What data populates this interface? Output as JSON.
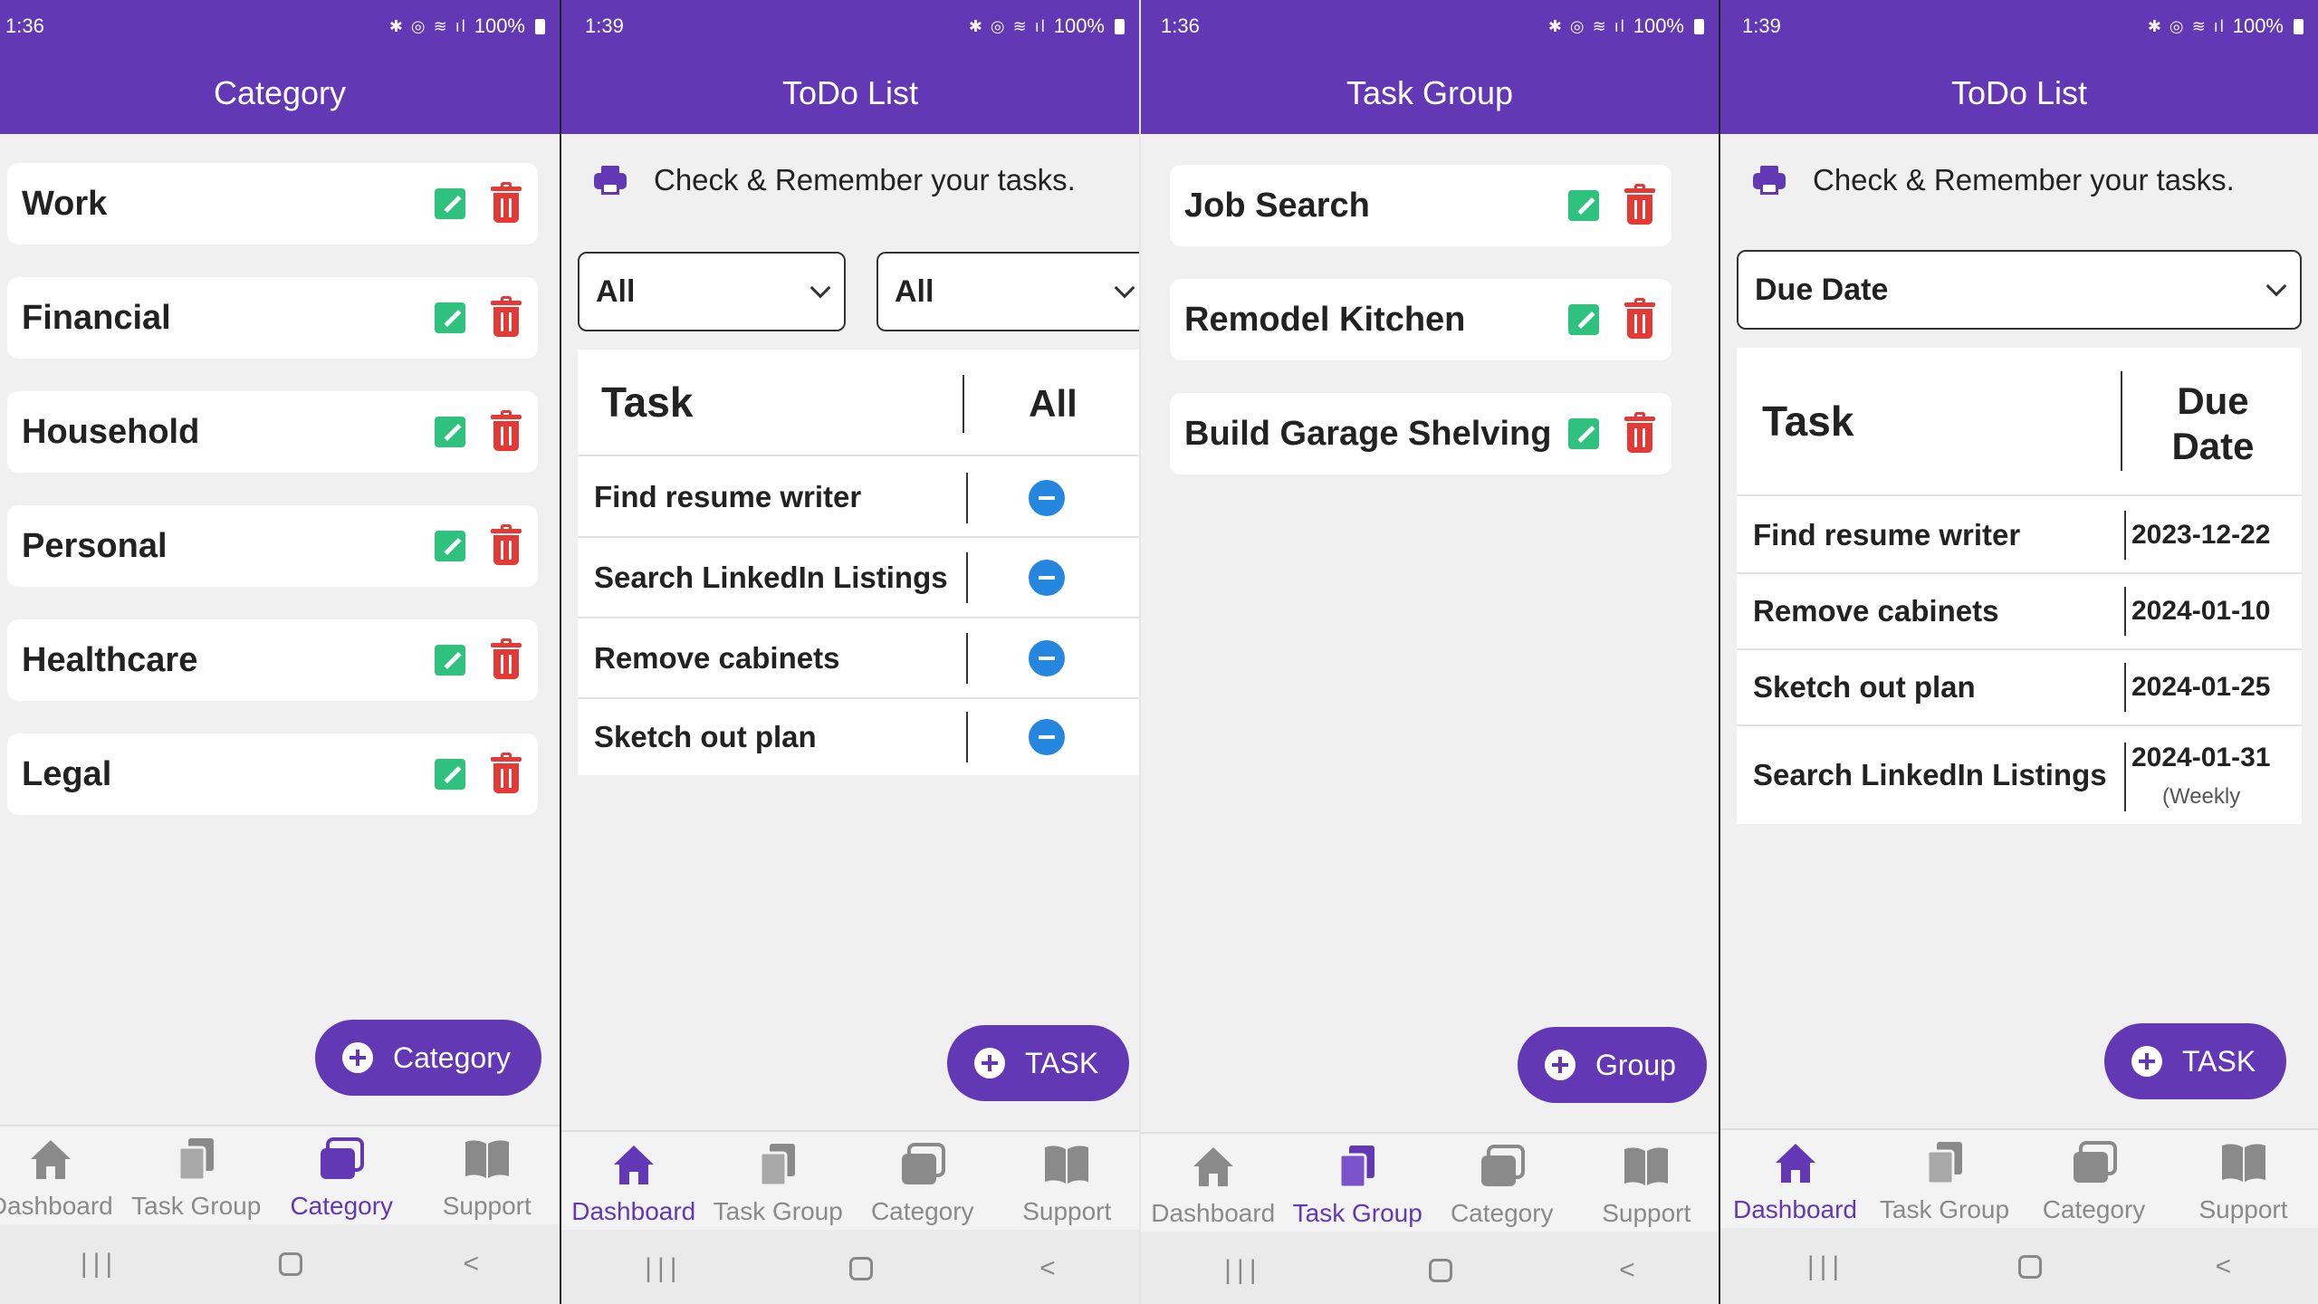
{
  "theme": {
    "primary": "#6238b5",
    "edit_green": "#2ec27e",
    "delete_red": "#e53935",
    "minus_blue": "#2586e0"
  },
  "status": {
    "battery": "100%",
    "icons": "✱ ◎ ≋ ıl"
  },
  "nav": {
    "dashboard": "Dashboard",
    "task_group": "Task Group",
    "category": "Category",
    "support": "Support",
    "dashboard_clipped": "Dashboard",
    "system": {
      "recents": "|||",
      "back": "<"
    }
  },
  "screen1": {
    "time": "1:36",
    "title": "Category",
    "items": [
      "Work",
      "Financial",
      "Household",
      "Personal",
      "Healthcare",
      "Legal"
    ],
    "fab_label": "Category",
    "active_tab": "Category"
  },
  "screen2": {
    "time": "1:39",
    "title": "ToDo List",
    "header_text": "Check & Remember your tasks.",
    "filter1": "All",
    "filter2": "All",
    "col_task": "Task",
    "col_status": "All",
    "rows": [
      "Find resume writer",
      "Search LinkedIn Listings",
      "Remove cabinets",
      "Sketch out plan"
    ],
    "fab_label": "TASK",
    "active_tab": "Dashboard"
  },
  "screen3": {
    "time": "1:36",
    "title": "Task Group",
    "items": [
      "Job Search",
      "Remodel Kitchen",
      "Build Garage Shelving"
    ],
    "fab_label": "Group",
    "active_tab": "Task Group"
  },
  "screen4": {
    "time": "1:39",
    "title": "ToDo List",
    "header_text": "Check & Remember your tasks.",
    "sort": "Due Date",
    "col_task": "Task",
    "col_due_line1": "Due",
    "col_due_line2": "Date",
    "rows": [
      {
        "task": "Find resume writer",
        "date": "2023-12-22"
      },
      {
        "task": "Remove cabinets",
        "date": "2024-01-10"
      },
      {
        "task": "Sketch out plan",
        "date": "2024-01-25"
      },
      {
        "task": "Search LinkedIn Listings",
        "date": "2024-01-31",
        "note": "(Weekly"
      }
    ],
    "fab_label": "TASK",
    "active_tab": "Dashboard"
  }
}
